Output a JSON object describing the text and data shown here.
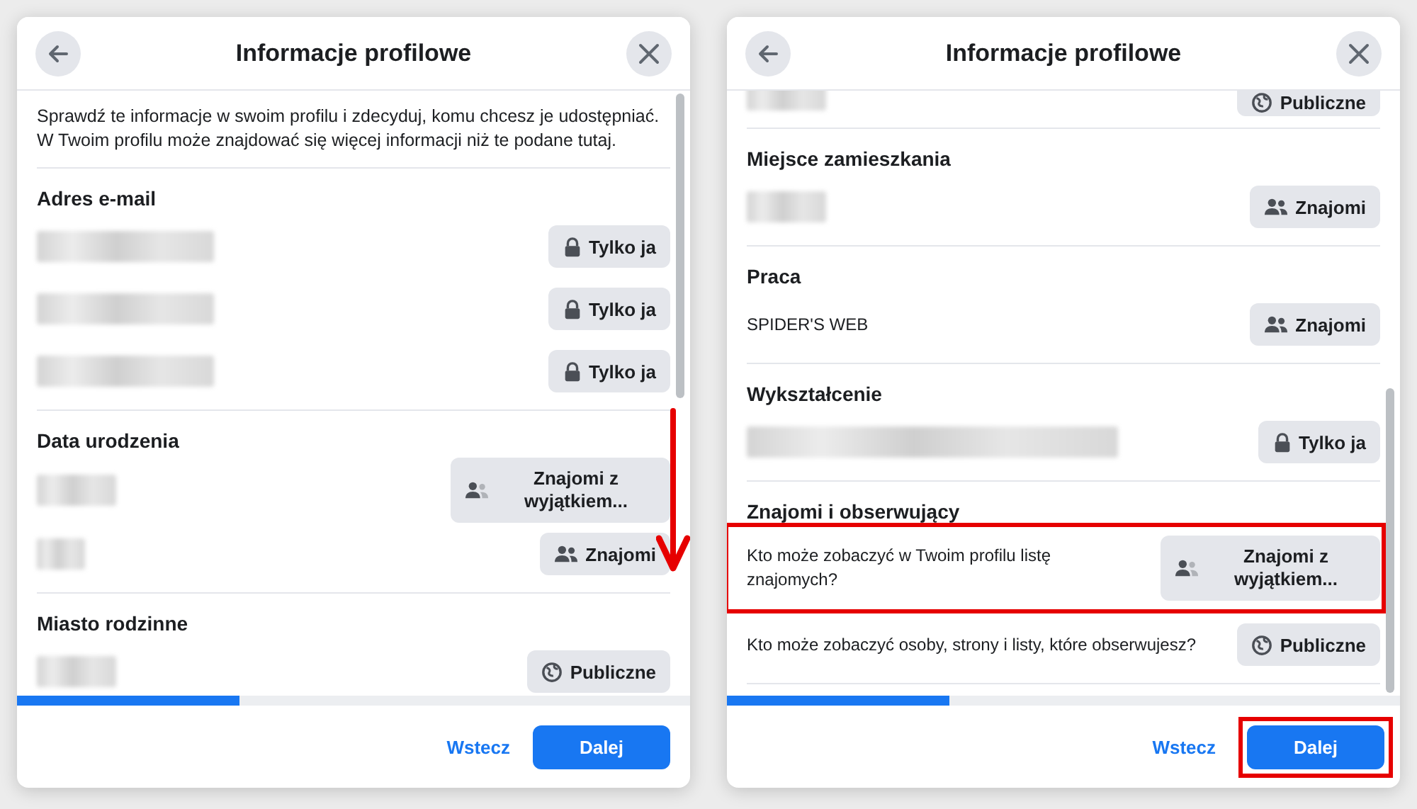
{
  "dialogs": [
    {
      "title": "Informacje profilowe",
      "intro": "Sprawdź te informacje w swoim profilu i zdecyduj, komu chcesz je udostępniać. W Twoim profilu może znajdować się więcej informacji niż te podane tutaj.",
      "scroll_arrow": true,
      "sections": [
        {
          "heading": "Adres e-mail",
          "rows": [
            {
              "kind": "blurred",
              "highlighted": false,
              "audience": {
                "kind": "lock",
                "label": "Tylko ja"
              }
            },
            {
              "kind": "blurred",
              "highlighted": false,
              "audience": {
                "kind": "lock",
                "label": "Tylko ja"
              }
            },
            {
              "kind": "blurred",
              "highlighted": false,
              "audience": {
                "kind": "lock",
                "label": "Tylko ja"
              }
            }
          ]
        },
        {
          "heading": "Data urodzenia",
          "rows": [
            {
              "kind": "blurred_short",
              "highlighted": false,
              "audience": {
                "kind": "friends_except",
                "label": "Znajomi z wyjątkiem..."
              }
            },
            {
              "kind": "blurred_tiny",
              "highlighted": false,
              "audience": {
                "kind": "friends",
                "label": "Znajomi"
              }
            }
          ]
        },
        {
          "heading": "Miasto rodzinne",
          "rows": [
            {
              "kind": "blurred_short",
              "highlighted": false,
              "audience": {
                "kind": "globe",
                "label": "Publiczne"
              }
            }
          ]
        }
      ],
      "progress": {
        "level": 0.33
      },
      "footer": {
        "back": "Wstecz",
        "next": "Dalej",
        "next_highlighted": false
      }
    },
    {
      "title": "Informacje profilowe",
      "scroll_arrow": false,
      "cut_row": {
        "kind": "blurred_short",
        "audience": {
          "kind": "globe",
          "label": "Publiczne"
        }
      },
      "sections": [
        {
          "heading": "Miejsce zamieszkania",
          "rows": [
            {
              "kind": "blurred_short",
              "highlighted": false,
              "audience": {
                "kind": "friends",
                "label": "Znajomi"
              }
            }
          ]
        },
        {
          "heading": "Praca",
          "rows": [
            {
              "kind": "text",
              "text": "SPIDER'S WEB",
              "highlighted": false,
              "audience": {
                "kind": "friends",
                "label": "Znajomi"
              }
            }
          ]
        },
        {
          "heading": "Wykształcenie",
          "rows": [
            {
              "kind": "blurred_long",
              "highlighted": false,
              "audience": {
                "kind": "lock",
                "label": "Tylko ja"
              }
            }
          ]
        },
        {
          "heading": "Znajomi i obserwujący",
          "rows": [
            {
              "kind": "text",
              "text": "Kto może zobaczyć w Twoim profilu listę znajomych?",
              "highlighted": true,
              "audience": {
                "kind": "friends_except",
                "label": "Znajomi z wyjątkiem..."
              }
            },
            {
              "kind": "text",
              "text": "Kto może zobaczyć osoby, strony i listy, które obserwujesz?",
              "highlighted": false,
              "audience": {
                "kind": "globe",
                "label": "Publiczne"
              }
            }
          ]
        }
      ],
      "progress": {
        "level": 0.33
      },
      "footer": {
        "back": "Wstecz",
        "next": "Dalej",
        "next_highlighted": true
      }
    }
  ]
}
